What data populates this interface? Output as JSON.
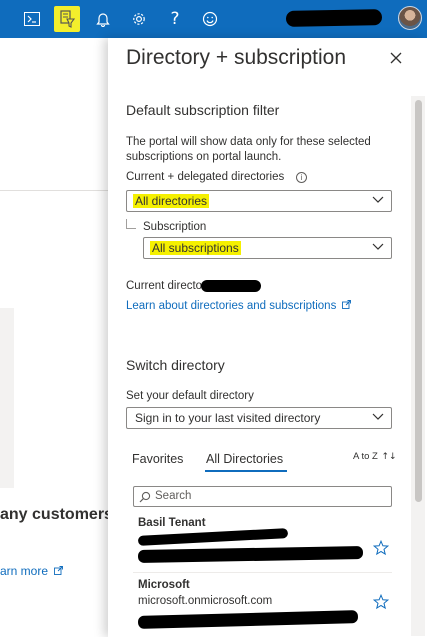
{
  "topbar": {
    "icons": [
      "cloud-shell-icon",
      "directory-filter-icon",
      "notifications-bell-icon",
      "settings-gear-icon",
      "help-icon",
      "feedback-smiley-icon"
    ],
    "help_glyph": "?",
    "highlight_color": "#f3ee2c",
    "bar_color": "#0f6cbd"
  },
  "background": {
    "heading": "any customers",
    "learn_more": "arn more"
  },
  "panel": {
    "title": "Directory + subscription",
    "default_filter": {
      "title": "Default subscription filter",
      "description": "The portal will show data only for these selected subscriptions on portal launch.",
      "directories_label": "Current + delegated directories",
      "directories_value": "All directories",
      "subscription_label": "Subscription",
      "subscription_value": "All subscriptions"
    },
    "current_directory_label": "Current directory",
    "learn_link": "Learn about directories and subscriptions",
    "switch": {
      "title": "Switch directory",
      "default_label": "Set your default directory",
      "default_value": "Sign in to your last visited directory",
      "tabs": [
        "Favorites",
        "All Directories"
      ],
      "active_tab": "All Directories",
      "sort_label": "A to Z",
      "search_placeholder": "Search",
      "directories": [
        {
          "name": "Basil Tenant"
        },
        {
          "name": "Microsoft",
          "domain": "microsoft.onmicrosoft.com"
        }
      ]
    }
  }
}
